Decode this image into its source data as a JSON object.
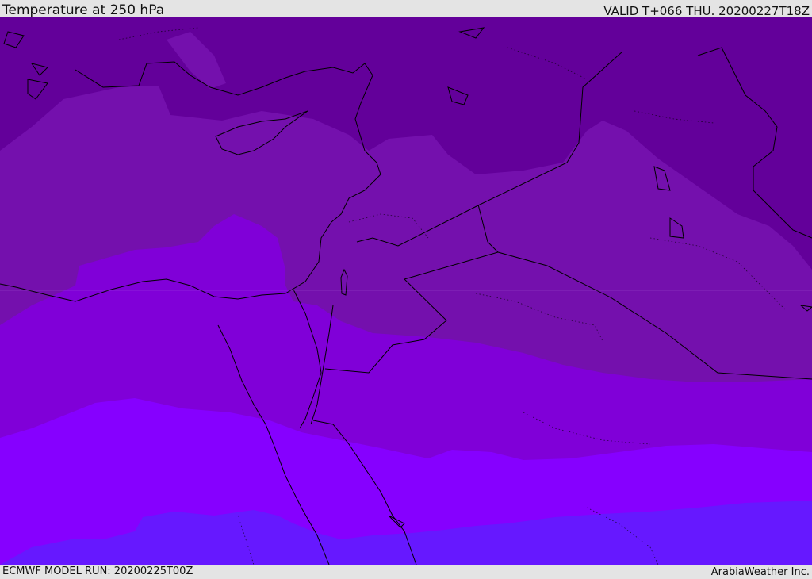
{
  "header": {
    "title": "Temperature at 250 hPa",
    "valid": "VALID T+066 THU. 20200227T18Z"
  },
  "footer": {
    "model_run": "ECMWF MODEL RUN: 20200225T00Z",
    "provider": "ArabiaWeather Inc."
  },
  "colors": {
    "band_darkest": "#63009a",
    "band_dark": "#7410ad",
    "band_mid": "#8000d8",
    "band_bright": "#8600ff",
    "band_blue": "#6618ff",
    "coast_line": "#000000"
  }
}
